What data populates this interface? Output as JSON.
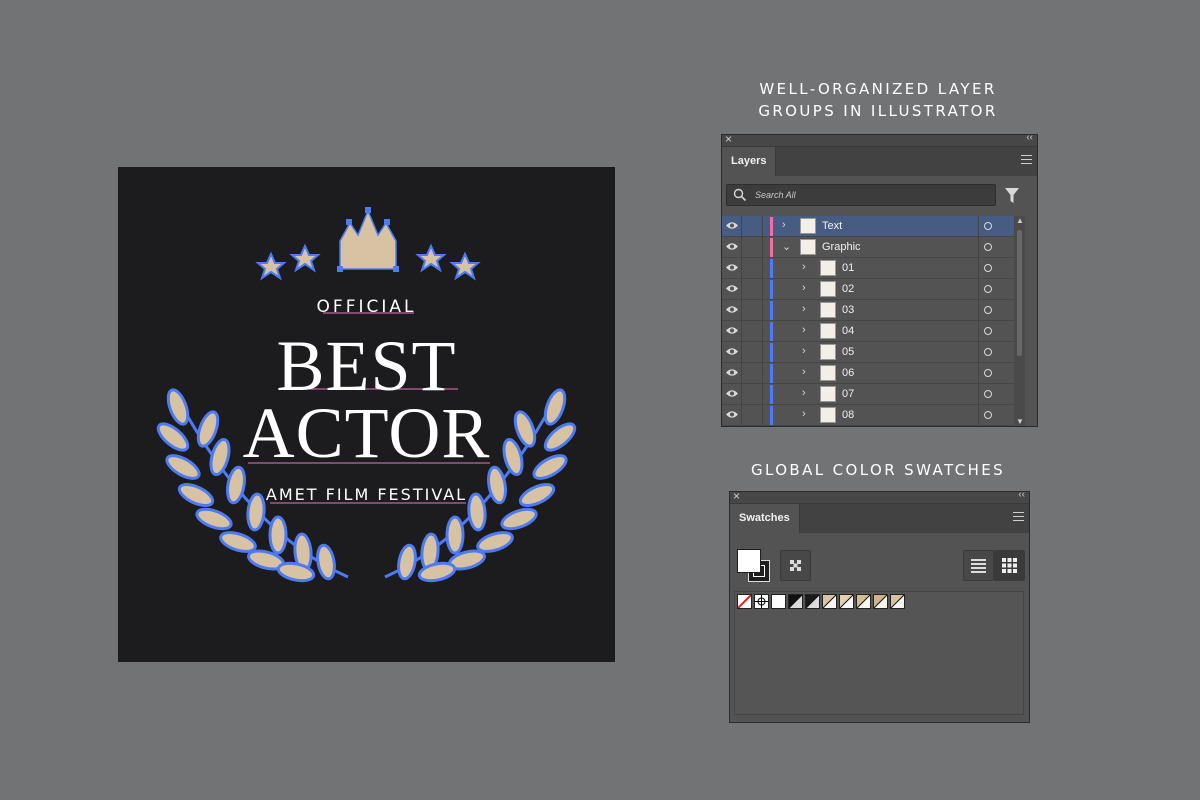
{
  "artwork": {
    "line1": "OFFICIAL",
    "line2": "BEST",
    "line3": "ACTOR",
    "line4": "AMET FILM FESTIVAL",
    "colors": {
      "background": "#1c1b1d",
      "gold": "#d7c3a4",
      "selection": "#4c7bf4",
      "text": "#ffffff"
    }
  },
  "captions": {
    "layers_line1": "WELL-ORGANIZED LAYER",
    "layers_line2": "GROUPS IN ILLUSTRATOR",
    "swatches": "GLOBAL COLOR SWATCHES"
  },
  "layers_panel": {
    "tab": "Layers",
    "search_placeholder": "Search All",
    "icons": [
      "close-icon",
      "collapse-icon",
      "panel-menu-icon",
      "search-icon",
      "filter-icon",
      "eye-icon",
      "chevron-right-icon",
      "chevron-down-icon",
      "target-circle-icon"
    ],
    "rows": [
      {
        "name": "Text",
        "selected": true,
        "color": "#f06fa5",
        "expanded": false,
        "indent": 0
      },
      {
        "name": "Graphic",
        "selected": false,
        "color": "#f06fa5",
        "expanded": true,
        "indent": 0
      },
      {
        "name": "01",
        "selected": false,
        "color": "#4c7bf4",
        "expanded": false,
        "indent": 1
      },
      {
        "name": "02",
        "selected": false,
        "color": "#4c7bf4",
        "expanded": false,
        "indent": 1
      },
      {
        "name": "03",
        "selected": false,
        "color": "#4c7bf4",
        "expanded": false,
        "indent": 1
      },
      {
        "name": "04",
        "selected": false,
        "color": "#4c7bf4",
        "expanded": false,
        "indent": 1
      },
      {
        "name": "05",
        "selected": false,
        "color": "#4c7bf4",
        "expanded": false,
        "indent": 1
      },
      {
        "name": "06",
        "selected": false,
        "color": "#4c7bf4",
        "expanded": false,
        "indent": 1
      },
      {
        "name": "07",
        "selected": false,
        "color": "#4c7bf4",
        "expanded": false,
        "indent": 1
      },
      {
        "name": "08",
        "selected": false,
        "color": "#4c7bf4",
        "expanded": false,
        "indent": 1
      }
    ]
  },
  "swatches_panel": {
    "tab": "Swatches",
    "icons": [
      "close-icon",
      "collapse-icon",
      "panel-menu-icon",
      "fill-stroke-icon",
      "swatch-options-icon",
      "list-view-icon",
      "grid-view-icon"
    ],
    "swatch_colors": [
      "none",
      "registration",
      "#ffffff",
      "#111111",
      "#1a1a1a",
      "#d9c4a3",
      "#e2d0b2",
      "#d3bb95",
      "#cdb38b",
      "#d8c29e"
    ]
  }
}
